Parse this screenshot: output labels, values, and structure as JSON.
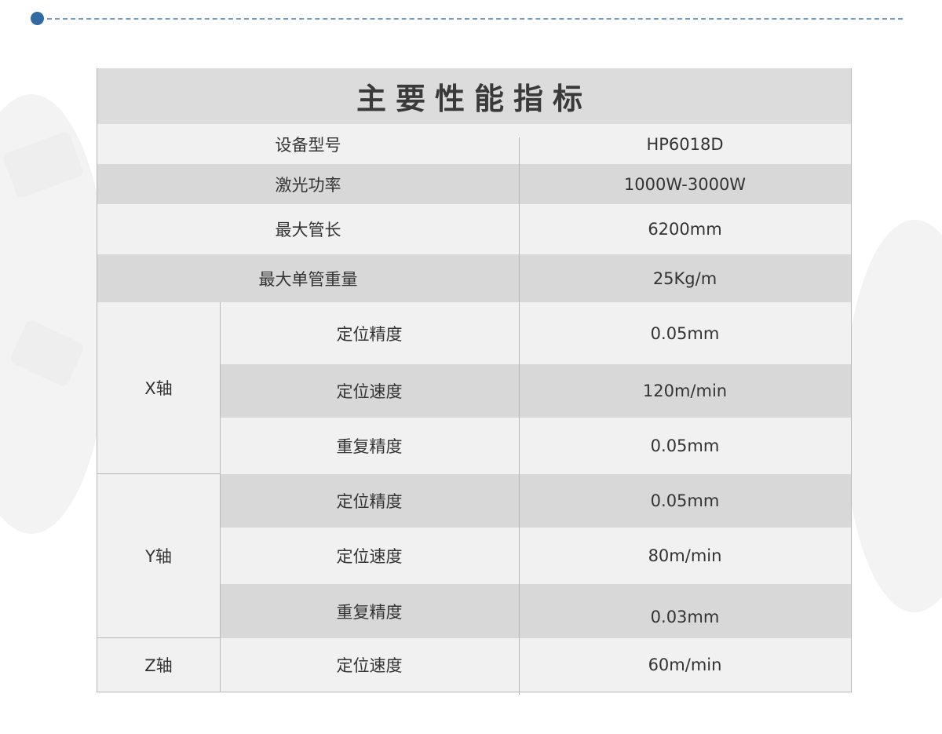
{
  "table": {
    "title": "主要性能指标",
    "rows": [
      {
        "label": "设备型号",
        "value": "HP6018D"
      },
      {
        "label": "激光功率",
        "value": "1000W-3000W"
      },
      {
        "label": "最大管长",
        "value": "6200mm"
      },
      {
        "label": "最大单管重量",
        "value": "25Kg/m"
      }
    ],
    "axes": [
      {
        "name": "X轴",
        "items": [
          {
            "label": "定位精度",
            "value": "0.05mm"
          },
          {
            "label": "定位速度",
            "value": "120m/min"
          },
          {
            "label": "重复精度",
            "value": "0.05mm"
          }
        ]
      },
      {
        "name": "Y轴",
        "items": [
          {
            "label": "定位精度",
            "value": "0.05mm"
          },
          {
            "label": "定位速度",
            "value": "80m/min"
          },
          {
            "label": "重复精度",
            "value": "0.03mm"
          }
        ]
      },
      {
        "name": "Z轴",
        "items": [
          {
            "label": "定位速度",
            "value": "60m/min"
          }
        ]
      }
    ]
  }
}
